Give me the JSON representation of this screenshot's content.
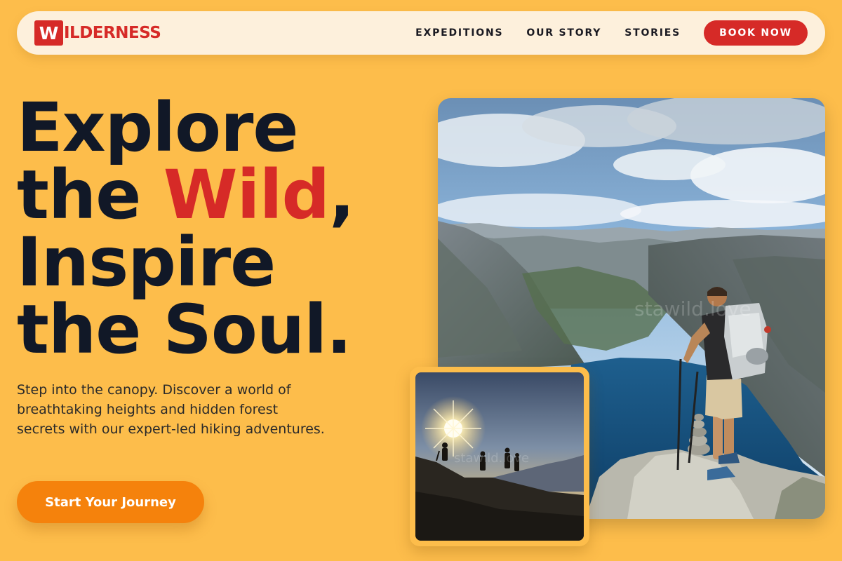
{
  "header": {
    "logo_letter": "W",
    "logo_text": "ILDERNESS",
    "nav_links": [
      "EXPEDITIONS",
      "OUR STORY",
      "STORIES"
    ],
    "book_label": "BOOK NOW"
  },
  "hero": {
    "line1": "Explore",
    "line2_pre": "the ",
    "line2_accent": "Wild",
    "line2_post": ",",
    "line3": "Inspire",
    "line4": "the Soul.",
    "subtitle": "Step into the canopy. Discover a world of breathtaking heights and hidden forest secrets with our expert-led hiking adventures.",
    "cta_label": "Start Your Journey"
  },
  "images": {
    "main_watermark": "stawild.love",
    "small_watermark": "stawild.love"
  },
  "colors": {
    "background": "#fdbd4b",
    "brand_red": "#d62a27",
    "cta_orange": "#f5820c",
    "heading_dark": "#111827",
    "navbar_bg": "#fdf0dc"
  }
}
